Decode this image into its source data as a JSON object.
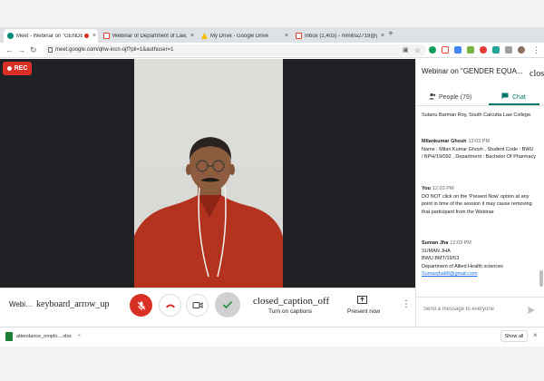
{
  "browser": {
    "tabs": [
      {
        "title": "Meet - Webinar on \"GENDE",
        "active": true,
        "favicon": "meet-icon"
      },
      {
        "title": "Webinar of Department of Law, I",
        "active": false,
        "favicon": "gmail-icon"
      },
      {
        "title": "My Drive - Google Drive",
        "active": false,
        "favicon": "drive-icon"
      },
      {
        "title": "Inbox (2,403) - mmitra2719@gm",
        "active": false,
        "favicon": "gmail-icon"
      }
    ],
    "new_tab": "+",
    "url": "meet.google.com/qhw-incn-ojf?pli=1&authuser=1"
  },
  "meet": {
    "rec_label": "REC",
    "controls": {
      "meeting_title": "Webi…",
      "arrow_icon_text": "keyboard_arrow_up",
      "captions_icon_text": "closed_caption_off",
      "captions_label": "Turn on captions",
      "present_label": "Present now"
    }
  },
  "sidebar": {
    "title": "Webinar on \"GENDER EQUA...",
    "close_text": "clos",
    "people_label": "People (79)",
    "chat_label": "Chat",
    "messages": [
      {
        "sender": "",
        "time": "",
        "text": "Sutanu Barman Roy, South Calcutta Law College."
      },
      {
        "sender": "Milankumar Ghosh",
        "time": "12:03 PM",
        "text": "Name : Milan Kumar Ghosh , Student Code : BWU / BPH/19/092 , Department : Bachelor Of Pharmacy"
      },
      {
        "sender": "You",
        "time": "12:03 PM",
        "text": "DO NOT click on the 'Present Now' option at any point in time of the session it may cause removing that participant from the Webinar."
      },
      {
        "sender": "Suman Jha",
        "time": "12:03 PM",
        "lines": [
          "SUMAN JHA",
          "BWU BMT/19/53",
          "Department of Allied Health sciences"
        ],
        "link": "Sumanjha88@gmail.com"
      }
    ],
    "compose_placeholder": "Send a message to everyone"
  },
  "downloads": {
    "file": "attendance_emplo....xlsx",
    "show_all": "Show all"
  },
  "colors": {
    "accent_teal": "#00796b",
    "rec_red": "#d93025",
    "hangup_red": "#d93025",
    "meet_dark": "#202124"
  }
}
